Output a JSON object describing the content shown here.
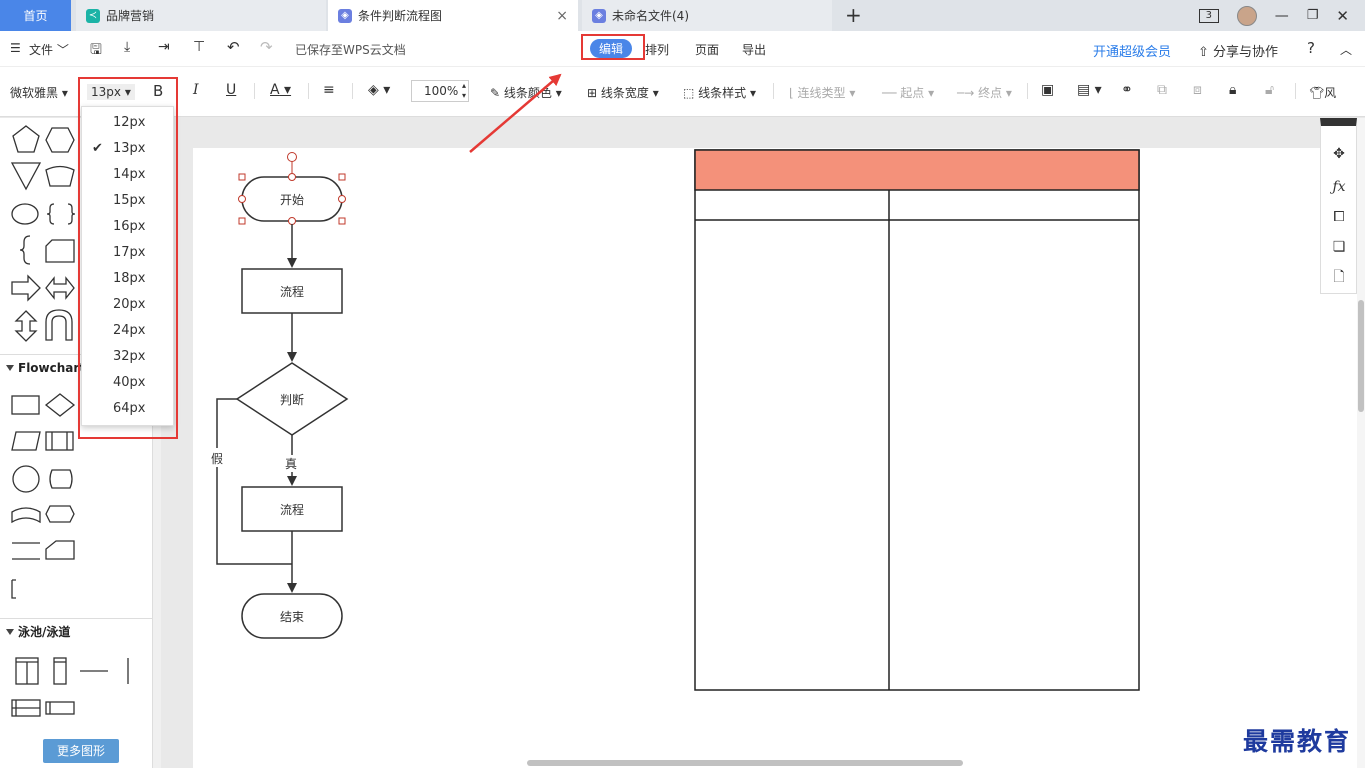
{
  "tabs": {
    "home": "首页",
    "brand": "品牌营销",
    "active": "条件判断流程图",
    "unnamed": "未命名文件(4)",
    "close": "×",
    "plus": "+",
    "count_badge": "3"
  },
  "menu": {
    "file": "文件",
    "saved_status": "已保存至WPS云文档",
    "edit": "编辑",
    "arrange": "排列",
    "page": "页面",
    "export": "导出",
    "vip": "开通超级会员",
    "share": "分享与协作",
    "help": "?"
  },
  "toolbar": {
    "font": "微软雅黑",
    "font_size": "13px",
    "bold": "B",
    "italic": "I",
    "underline": "U",
    "font_color": "A",
    "zoom": "100%",
    "line_color": "线条颜色",
    "line_width": "线条宽度",
    "line_style": "线条样式",
    "connector_type": "连线类型",
    "start_point": "起点",
    "end_point": "终点",
    "style": "风"
  },
  "font_size_options": [
    {
      "label": "12px",
      "selected": false
    },
    {
      "label": "13px",
      "selected": true
    },
    {
      "label": "14px",
      "selected": false
    },
    {
      "label": "15px",
      "selected": false
    },
    {
      "label": "16px",
      "selected": false
    },
    {
      "label": "17px",
      "selected": false
    },
    {
      "label": "18px",
      "selected": false
    },
    {
      "label": "20px",
      "selected": false
    },
    {
      "label": "24px",
      "selected": false
    },
    {
      "label": "32px",
      "selected": false
    },
    {
      "label": "40px",
      "selected": false
    },
    {
      "label": "64px",
      "selected": false
    }
  ],
  "left_panel": {
    "flowchart_section": "Flowchart",
    "pool_section": "泳池/泳道",
    "more_shapes": "更多图形"
  },
  "flowchart": {
    "start": "开始",
    "process1": "流程",
    "decision": "判断",
    "true_label": "真",
    "false_label": "假",
    "process2": "流程",
    "end": "结束"
  },
  "colors": {
    "accent": "#4a86e8",
    "table_header": "#f4917a",
    "highlight": "#e53935",
    "button": "#5b9bd5"
  },
  "watermark": "最需教育"
}
